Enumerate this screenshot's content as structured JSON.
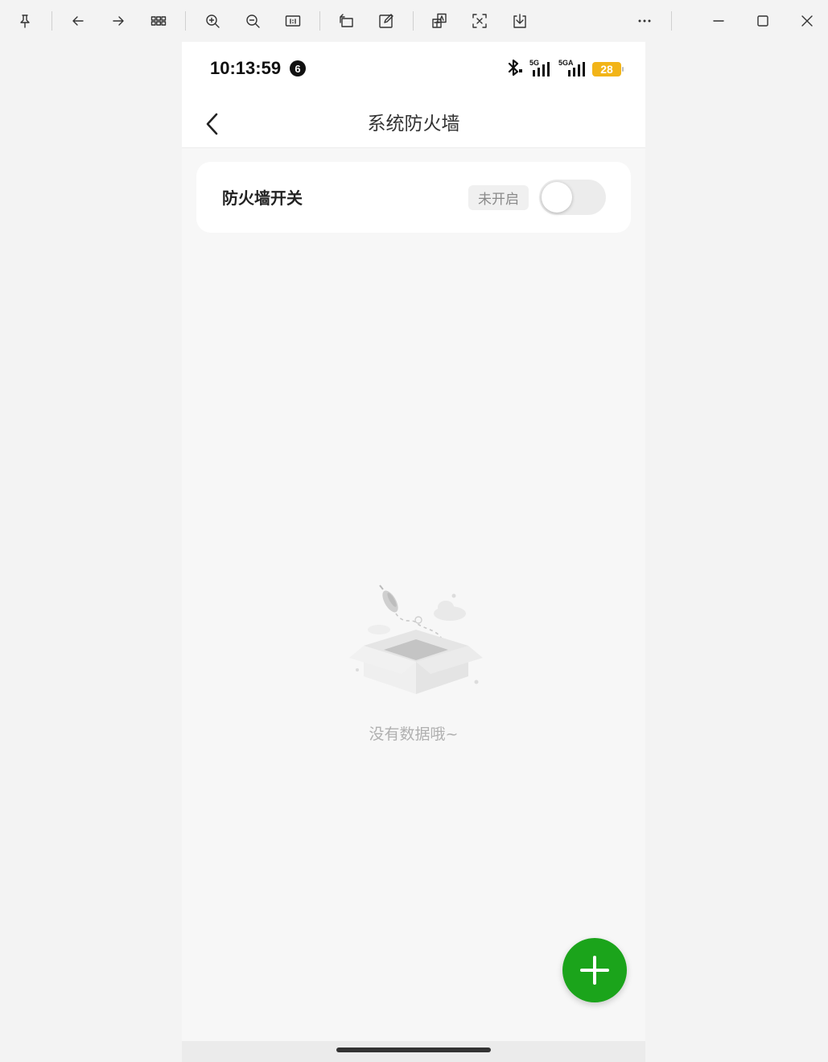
{
  "toolbar": {
    "buttons": [
      {
        "icon": "pin-icon"
      },
      {
        "icon": "arrow-left-icon"
      },
      {
        "icon": "arrow-right-icon"
      },
      {
        "icon": "grid-view-icon"
      },
      {
        "icon": "zoom-in-icon"
      },
      {
        "icon": "zoom-out-icon"
      },
      {
        "icon": "actual-size-icon"
      },
      {
        "icon": "rotate-icon"
      },
      {
        "icon": "edit-icon"
      },
      {
        "icon": "translate-icon"
      },
      {
        "icon": "ocr-icon"
      },
      {
        "icon": "download-icon"
      },
      {
        "icon": "more-icon"
      },
      {
        "icon": "minimize-icon"
      },
      {
        "icon": "maximize-icon"
      },
      {
        "icon": "close-icon"
      }
    ]
  },
  "status_bar": {
    "time": "10:13:59",
    "notification_count": "6",
    "signal_1_label": "5G",
    "signal_2_label": "5GA",
    "battery_level": "28",
    "battery_color": "#f2b418"
  },
  "nav": {
    "title": "系统防火墙"
  },
  "firewall_card": {
    "label": "防火墙开关",
    "status": "未开启",
    "enabled": false
  },
  "empty_state": {
    "text": "没有数据哦~"
  },
  "colors": {
    "accent": "#1ba41b",
    "page_bg": "#f7f7f7"
  }
}
